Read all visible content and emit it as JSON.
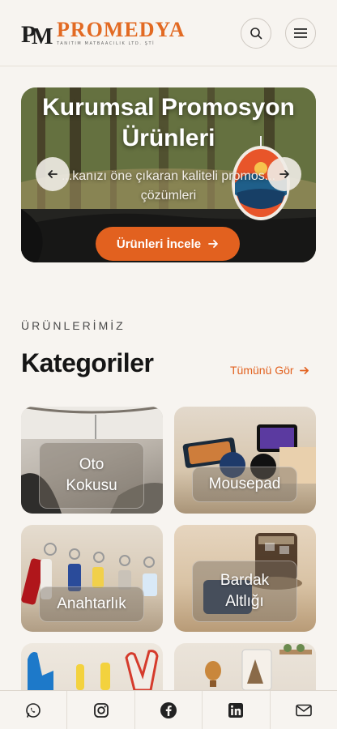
{
  "header": {
    "logo_mark": "PM",
    "logo_name": "PROMEDYA",
    "logo_subtitle": "TANITIM MATBAACILIK LTD. ŞTİ",
    "search_icon": "search-icon",
    "menu_icon": "hamburger-menu-icon"
  },
  "hero": {
    "title": "Kurumsal Promosyon Ürünleri",
    "subtitle": "...kanızı öne çıkaran kaliteli promos... çözümleri",
    "cta_label": "Ürünleri İncele",
    "prev_icon": "arrow-left-icon",
    "next_icon": "arrow-right-icon"
  },
  "section": {
    "eyebrow": "ÜRÜNLERİMİZ",
    "title": "Kategoriler",
    "see_all": "Tümünü Gör"
  },
  "categories": [
    {
      "label_line1": "Oto",
      "label_line2": "Kokusu"
    },
    {
      "label_line1": "Mousepad",
      "label_line2": ""
    },
    {
      "label_line1": "Anahtarlık",
      "label_line2": ""
    },
    {
      "label_line1": "Bardak",
      "label_line2": "Altlığı"
    },
    {
      "label_line1": "",
      "label_line2": ""
    },
    {
      "label_line1": "",
      "label_line2": ""
    }
  ],
  "bottom_bar": {
    "items": [
      "whatsapp-icon",
      "instagram-icon",
      "facebook-icon",
      "linkedin-icon",
      "mail-icon"
    ]
  },
  "colors": {
    "accent": "#e2611f",
    "background": "#f7f4f0",
    "text": "#151515"
  }
}
